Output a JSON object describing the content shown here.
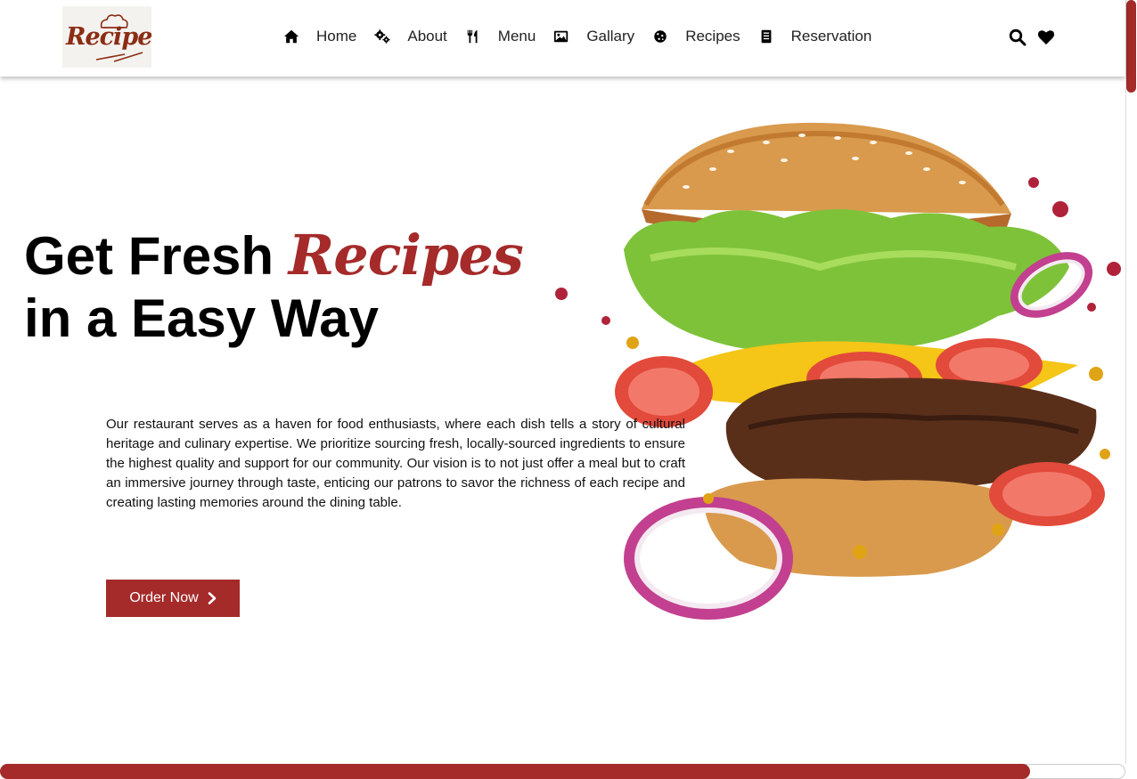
{
  "brand": {
    "logo_text": "Recipes"
  },
  "nav": [
    {
      "label": "Home",
      "icon": "home-icon"
    },
    {
      "label": "About",
      "icon": "gears-icon"
    },
    {
      "label": "Menu",
      "icon": "utensils-icon"
    },
    {
      "label": "Gallary",
      "icon": "image-icon"
    },
    {
      "label": "Recipes",
      "icon": "cookie-icon"
    },
    {
      "label": "Reservation",
      "icon": "clipboard-icon"
    }
  ],
  "header_actions": {
    "search_icon": "search-icon",
    "wishlist_icon": "heart-icon"
  },
  "hero": {
    "title_part1": "Get Fresh ",
    "title_accent": "Recipes",
    "title_line2": "in a Easy Way",
    "description": "Our restaurant serves as a haven for food enthusiasts, where each dish tells a story of cultural heritage and culinary expertise. We prioritize sourcing fresh, locally-sourced ingredients to ensure the highest quality and support for our community. Our vision is to not just offer a meal but to craft an immersive journey through taste, enticing our patrons to savor the richness of each recipe and creating lasting memories around the dining table.",
    "cta_label": "Order Now"
  },
  "colors": {
    "accent": "#a52a2a",
    "text": "#000000",
    "nav_text": "#222222"
  }
}
